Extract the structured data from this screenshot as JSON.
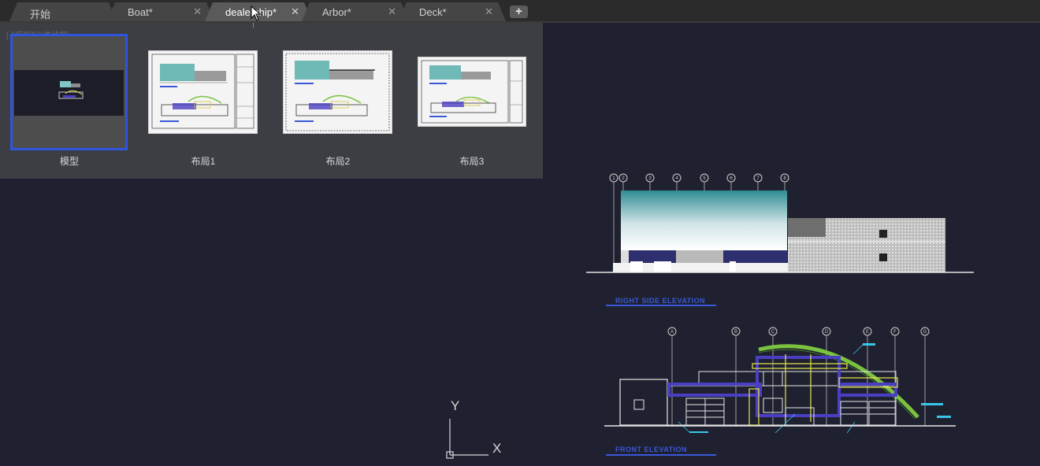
{
  "tabs": [
    {
      "label": "开始",
      "active": false,
      "closable": false
    },
    {
      "label": "Boat*",
      "active": false,
      "closable": true
    },
    {
      "label": "dealership*",
      "active": true,
      "closable": true
    },
    {
      "label": "Arbor*",
      "active": false,
      "closable": true
    },
    {
      "label": "Deck*",
      "active": false,
      "closable": true
    }
  ],
  "new_tab_symbol": "+",
  "close_symbol": "✕",
  "viewport_label": "[-][俯视][二维线框]",
  "layout_thumbnails": [
    {
      "label": "模型",
      "selected": true
    },
    {
      "label": "布局1",
      "selected": false
    },
    {
      "label": "布局2",
      "selected": false
    },
    {
      "label": "布局3",
      "selected": false
    }
  ],
  "drawing": {
    "right_side_title": "RIGHT SIDE ELEVATION",
    "front_title": "FRONT ELEVATION",
    "right_side_grid_markers": [
      "1",
      "2",
      "3",
      "4",
      "5",
      "6",
      "7",
      "8"
    ],
    "front_grid_markers": [
      "A",
      "B",
      "C",
      "D",
      "E",
      "F",
      "G"
    ]
  },
  "ucs": {
    "x_label": "X",
    "y_label": "Y"
  },
  "colors": {
    "background": "#1f2130",
    "selection_blue": "#2f55dd",
    "title_blue": "#3a58d8",
    "cyan": "#39c6e8",
    "yellow": "#e8e84a",
    "purple": "#4a3fc2"
  }
}
